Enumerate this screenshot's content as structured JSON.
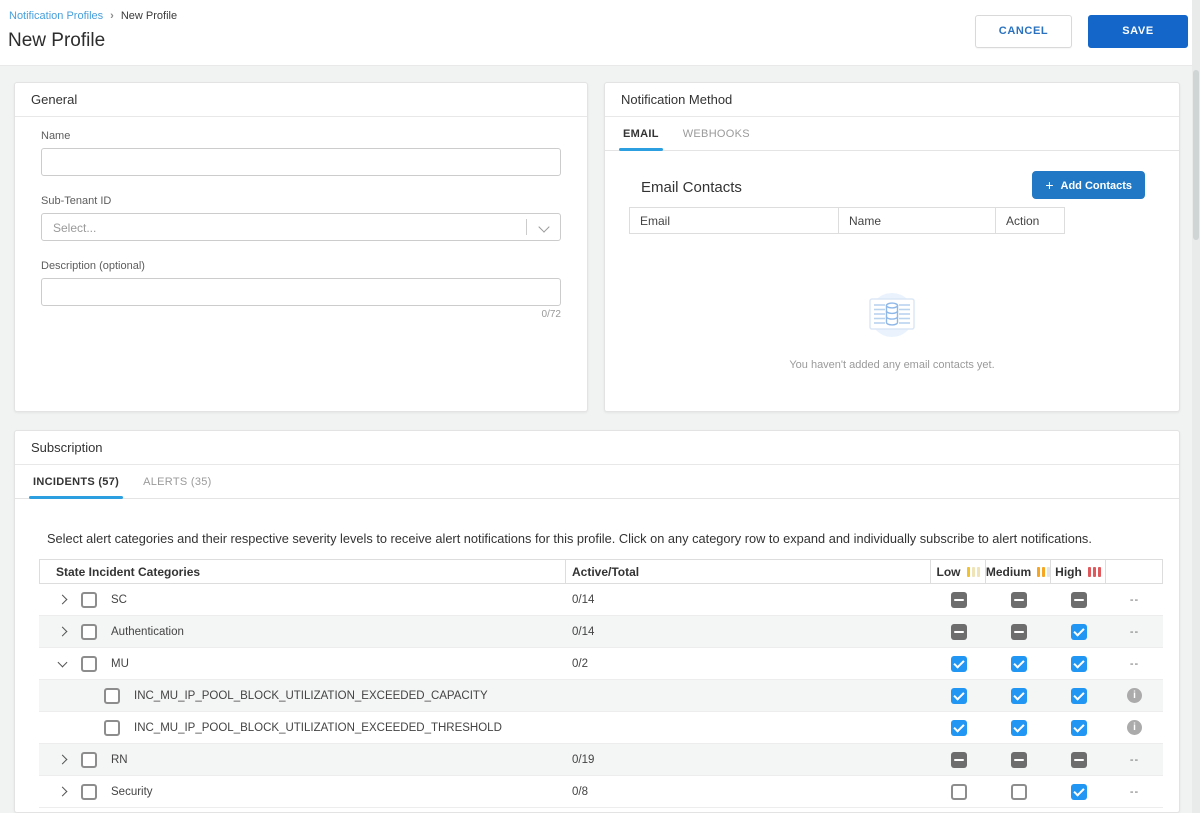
{
  "colors": {
    "primary_blue": "#1467c8",
    "link_blue": "#49a0dd",
    "tab_underline_blue": "#2b9fe0",
    "checkbox_checked_blue": "#2196f3",
    "add_button_blue": "#2178c4",
    "severity_low": "#f0c330",
    "severity_medium": "#f5a623",
    "severity_high": "#e0585c"
  },
  "icons": {
    "breadcrumb_separator": "›",
    "plus": "+",
    "info": "i"
  },
  "header": {
    "breadcrumb_link": "Notification Profiles",
    "breadcrumb_current": "New Profile",
    "title": "New Profile",
    "cancel_label": "CANCEL",
    "save_label": "SAVE"
  },
  "general": {
    "title": "General",
    "name_label": "Name",
    "name_value": "",
    "subtenant_label": "Sub-Tenant ID",
    "subtenant_placeholder": "Select...",
    "description_label": "Description (optional)",
    "description_value": "",
    "char_counter": "0/72"
  },
  "notification_method": {
    "title": "Notification Method",
    "tabs": [
      {
        "label": "EMAIL",
        "active": true
      },
      {
        "label": "WEBHOOKS",
        "active": false
      }
    ],
    "email_contacts": {
      "heading": "Email Contacts",
      "add_button_label": "Add Contacts",
      "columns": [
        "Email",
        "Name",
        "Action"
      ],
      "empty_message": "You haven't added any email contacts yet."
    }
  },
  "subscription": {
    "title": "Subscription",
    "tabs": [
      {
        "label": "INCIDENTS (57)",
        "active": true
      },
      {
        "label": "ALERTS (35)",
        "active": false
      }
    ],
    "description": "Select alert categories and their respective severity levels to receive alert notifications for this profile. Click on any category row to expand and individually subscribe to alert notifications.",
    "table": {
      "columns": [
        "State Incident Categories",
        "Active/Total",
        "Low",
        "Medium",
        "High"
      ],
      "rows": [
        {
          "name": "SC",
          "type": "category",
          "expand": "collapsed",
          "select": "unchecked",
          "active_total": "0/14",
          "low": "indeterminate",
          "medium": "indeterminate",
          "high": "indeterminate",
          "action_type": "dash",
          "action_text": "--"
        },
        {
          "name": "Authentication",
          "type": "category",
          "expand": "collapsed",
          "select": "unchecked",
          "active_total": "0/14",
          "low": "indeterminate",
          "medium": "indeterminate",
          "high": "checked",
          "action_type": "dash",
          "action_text": "--"
        },
        {
          "name": "MU",
          "type": "category",
          "expand": "expanded",
          "select": "unchecked",
          "active_total": "0/2",
          "low": "checked",
          "medium": "checked",
          "high": "checked",
          "action_type": "dash",
          "action_text": "--"
        },
        {
          "name": "INC_MU_IP_POOL_BLOCK_UTILIZATION_EXCEEDED_CAPACITY",
          "type": "child",
          "select": "unchecked",
          "active_total": "",
          "low": "checked",
          "medium": "checked",
          "high": "checked",
          "action_type": "info"
        },
        {
          "name": "INC_MU_IP_POOL_BLOCK_UTILIZATION_EXCEEDED_THRESHOLD",
          "type": "child",
          "select": "unchecked",
          "active_total": "",
          "low": "checked",
          "medium": "checked",
          "high": "checked",
          "action_type": "info"
        },
        {
          "name": "RN",
          "type": "category",
          "expand": "collapsed",
          "select": "unchecked",
          "active_total": "0/19",
          "low": "indeterminate",
          "medium": "indeterminate",
          "high": "indeterminate",
          "action_type": "dash",
          "action_text": "--"
        },
        {
          "name": "Security",
          "type": "category",
          "expand": "collapsed",
          "select": "unchecked",
          "active_total": "0/8",
          "low": "unchecked",
          "medium": "unchecked",
          "high": "checked",
          "action_type": "dash",
          "action_text": "--"
        }
      ]
    }
  }
}
